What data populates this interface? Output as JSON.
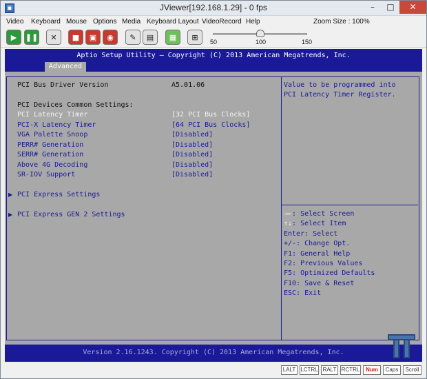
{
  "window": {
    "title": "JViewer[192.168.1.29] - 0 fps",
    "minimize": "–",
    "maximize": "□",
    "close": "✕"
  },
  "menu": [
    "Video",
    "Keyboard",
    "Mouse",
    "Options",
    "Media",
    "Keyboard Layout",
    "VideoRecord",
    "Help"
  ],
  "zoom": {
    "label": "Zoom Size : 100%",
    "scale_min": "50",
    "scale_mid": "100",
    "scale_max": "150",
    "value": 100
  },
  "toolbar": {
    "icons": [
      "play-icon",
      "pause-icon",
      "full-screen-icon",
      "record-icon",
      "save-icon",
      "cd-icon",
      "usb-icon",
      "keyboard-icon",
      "hard-disk-icon",
      "network-icon"
    ]
  },
  "bios": {
    "header": "Aptio Setup Utility – Copyright (C) 2013 American Megatrends, Inc.",
    "tab": "Advanced",
    "driver_label": "PCI Bus Driver Version",
    "driver_value": "A5.01.06",
    "section": "PCI Devices Common Settings:",
    "settings": [
      {
        "label": "PCI Latency Timer",
        "value": "[32 PCI Bus Clocks]"
      },
      {
        "label": "PCI-X Latency Timer",
        "value": "[64 PCI Bus Clocks]"
      },
      {
        "label": "VGA Palette Snoop",
        "value": "[Disabled]"
      },
      {
        "label": "PERR# Generation",
        "value": "[Disabled]"
      },
      {
        "label": "SERR# Generation",
        "value": "[Disabled]"
      },
      {
        "label": "Above 4G Decoding",
        "value": "[Disabled]"
      },
      {
        "label": "SR-IOV Support",
        "value": "[Disabled]"
      }
    ],
    "submenus": [
      "PCI Express Settings",
      "PCI Express GEN 2 Settings"
    ],
    "help": [
      "Value to be programmed into",
      "PCI Latency Timer Register."
    ],
    "keys": [
      {
        "key": "→←",
        "desc": ": Select Screen"
      },
      {
        "key": "↑↓",
        "desc": ": Select Item"
      },
      {
        "key": "",
        "desc": "Enter: Select"
      },
      {
        "key": "",
        "desc": "+/-: Change Opt."
      },
      {
        "key": "",
        "desc": "F1: General Help"
      },
      {
        "key": "",
        "desc": "F2: Previous Values"
      },
      {
        "key": "",
        "desc": "F5: Optimized Defaults"
      },
      {
        "key": "",
        "desc": "F10: Save & Reset"
      },
      {
        "key": "",
        "desc": "ESC: Exit"
      }
    ],
    "footer": "Version 2.16.1243. Copyright (C) 2013 American Megatrends, Inc."
  },
  "status_keys": [
    {
      "label": "LALT",
      "on": false
    },
    {
      "label": "LCTRL",
      "on": false
    },
    {
      "label": "RALT",
      "on": false
    },
    {
      "label": "RCTRL",
      "on": false
    },
    {
      "label": "Num",
      "on": true
    },
    {
      "label": "Caps",
      "on": false
    },
    {
      "label": "Scroll",
      "on": false
    }
  ]
}
